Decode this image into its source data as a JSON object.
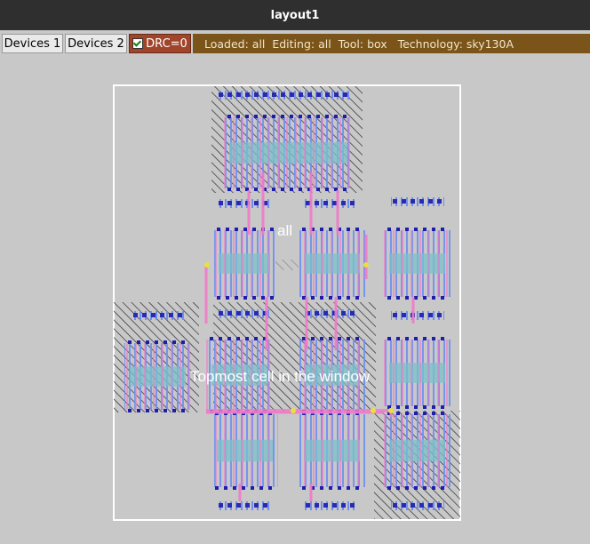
{
  "window": {
    "title": "layout1"
  },
  "toolbar": {
    "devices1_label": "Devices 1",
    "devices2_label": "Devices 2",
    "drc_label": "DRC=0",
    "drc_checked": true,
    "status_text": "Loaded: all  Editing: all  Tool: box   Technology: sky130A"
  },
  "canvas": {
    "cell_name": "all",
    "topmost_label": "Topmost cell in the window"
  },
  "colors": {
    "titlebar_bg": "#2f2f2f",
    "canvas_bg": "#c8c8c8",
    "status_bg": "#7a5418",
    "drc_bg": "#a0442a",
    "metal_blue": "#6f8ff0",
    "poly_pink": "#f07ac8",
    "diffusion_teal": "#6fc6b8"
  }
}
